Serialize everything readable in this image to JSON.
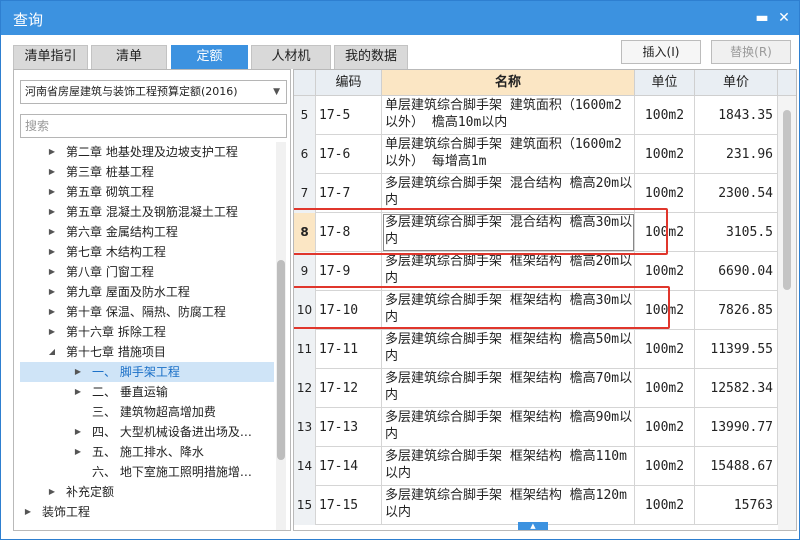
{
  "window": {
    "title": "查询"
  },
  "tabs": [
    {
      "label": "清单指引",
      "active": false
    },
    {
      "label": "清单",
      "active": false
    },
    {
      "label": "定额",
      "active": true
    },
    {
      "label": "人材机",
      "active": false
    },
    {
      "label": "我的数据",
      "active": false
    }
  ],
  "toolbar": {
    "insert_label": "插入(I)",
    "replace_label": "替换(R)"
  },
  "left": {
    "quota_library": "河南省房屋建筑与装饰工程预算定额(2016)",
    "search_placeholder": "搜索",
    "tree": [
      {
        "label": "第二章 地基处理及边坡支护工程",
        "level": 1,
        "toggle": "▶"
      },
      {
        "label": "第三章 桩基工程",
        "level": 1,
        "toggle": "▶"
      },
      {
        "label": "第五章 砌筑工程",
        "level": 1,
        "toggle": "▶"
      },
      {
        "label": "第五章 混凝土及钢筋混凝土工程",
        "level": 1,
        "toggle": "▶"
      },
      {
        "label": "第六章 金属结构工程",
        "level": 1,
        "toggle": "▶"
      },
      {
        "label": "第七章 木结构工程",
        "level": 1,
        "toggle": "▶"
      },
      {
        "label": "第八章 门窗工程",
        "level": 1,
        "toggle": "▶"
      },
      {
        "label": "第九章 屋面及防水工程",
        "level": 1,
        "toggle": "▶"
      },
      {
        "label": "第十章 保温、隔热、防腐工程",
        "level": 1,
        "toggle": "▶"
      },
      {
        "label": "第十六章 拆除工程",
        "level": 1,
        "toggle": "▶"
      },
      {
        "label": "第十七章 措施项目",
        "level": 1,
        "toggle": "◢"
      },
      {
        "label": "一、 脚手架工程",
        "level": 2,
        "toggle": "▶",
        "selected": true
      },
      {
        "label": "二、 垂直运输",
        "level": 2,
        "toggle": "▶"
      },
      {
        "label": "三、 建筑物超高增加费",
        "level": 2,
        "toggle": ""
      },
      {
        "label": "四、 大型机械设备进出场及…",
        "level": 2,
        "toggle": "▶"
      },
      {
        "label": "五、 施工排水、降水",
        "level": 2,
        "toggle": "▶"
      },
      {
        "label": "六、 地下室施工照明措施增…",
        "level": 2,
        "toggle": ""
      },
      {
        "label": "补充定额",
        "level": 1,
        "toggle": "▶"
      },
      {
        "label": "装饰工程",
        "level": 0,
        "toggle": "▶"
      }
    ]
  },
  "table": {
    "headers": {
      "code": "编码",
      "name": "名称",
      "unit": "单位",
      "price": "单价"
    },
    "rows": [
      {
        "idx": "5",
        "code": "17-5",
        "name": "单层建筑综合脚手架 建筑面积（1600m2以外） 檐高10m以内",
        "unit": "100m2",
        "price": "1843.35"
      },
      {
        "idx": "6",
        "code": "17-6",
        "name": "单层建筑综合脚手架 建筑面积（1600m2以外） 每增高1m",
        "unit": "100m2",
        "price": "231.96"
      },
      {
        "idx": "7",
        "code": "17-7",
        "name": "多层建筑综合脚手架 混合结构 檐高20m以内",
        "unit": "100m2",
        "price": "2300.54"
      },
      {
        "idx": "8",
        "code": "17-8",
        "name": "多层建筑综合脚手架 混合结构 檐高30m以内",
        "unit": "100m2",
        "price": "3105.5",
        "current": true
      },
      {
        "idx": "9",
        "code": "17-9",
        "name": "多层建筑综合脚手架 框架结构 檐高20m以内",
        "unit": "100m2",
        "price": "6690.04"
      },
      {
        "idx": "10",
        "code": "17-10",
        "name": "多层建筑综合脚手架 框架结构 檐高30m以内",
        "unit": "100m2",
        "price": "7826.85"
      },
      {
        "idx": "11",
        "code": "17-11",
        "name": "多层建筑综合脚手架 框架结构 檐高50m以内",
        "unit": "100m2",
        "price": "11399.55"
      },
      {
        "idx": "12",
        "code": "17-12",
        "name": "多层建筑综合脚手架 框架结构 檐高70m以内",
        "unit": "100m2",
        "price": "12582.34"
      },
      {
        "idx": "13",
        "code": "17-13",
        "name": "多层建筑综合脚手架 框架结构 檐高90m以内",
        "unit": "100m2",
        "price": "13990.77"
      },
      {
        "idx": "14",
        "code": "17-14",
        "name": "多层建筑综合脚手架 框架结构 檐高110m以内",
        "unit": "100m2",
        "price": "15488.67"
      },
      {
        "idx": "15",
        "code": "17-15",
        "name": "多层建筑综合脚手架 框架结构 檐高120m以内",
        "unit": "100m2",
        "price": "15763"
      }
    ]
  },
  "colors": {
    "accent": "#3c92e0",
    "highlight_box": "#e0362c",
    "header_name_bg": "#fbe6c4"
  }
}
